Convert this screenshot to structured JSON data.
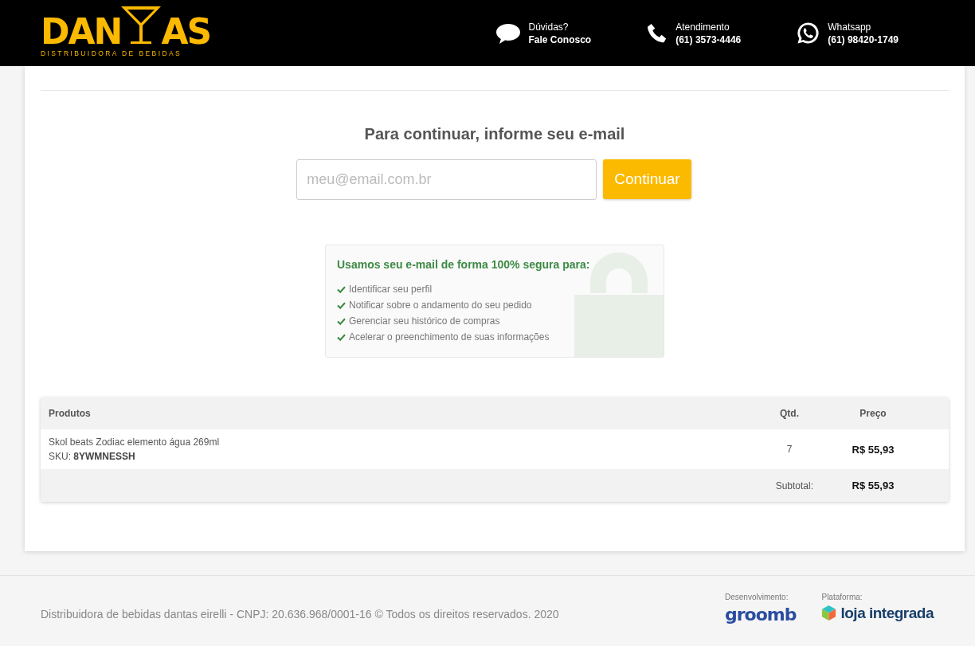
{
  "header": {
    "logo": {
      "left": "DAN",
      "right": "AS",
      "tagline": "DISTRIBUIDORA DE BEBIDAS"
    },
    "contacts": [
      {
        "kind": "chat",
        "label": "Dúvidas?",
        "value": "Fale Conosco"
      },
      {
        "kind": "phone",
        "label": "Atendimento",
        "value": "(61) 3573-4446"
      },
      {
        "kind": "whatsapp",
        "label": "Whatsapp",
        "value": "(61) 98420-1749"
      }
    ]
  },
  "email_step": {
    "title": "Para continuar, informe seu e-mail",
    "placeholder": "meu@email.com.br",
    "button": "Continuar"
  },
  "security": {
    "title": "Usamos seu e-mail de forma 100% segura para:",
    "items": [
      "Identificar seu perfil",
      "Notificar sobre o andamento do seu pedido",
      "Gerenciar seu histórico de compras",
      "Acelerar o preenchimento de suas informações"
    ]
  },
  "cart": {
    "columns": [
      "Produtos",
      "Qtd.",
      "Preço"
    ],
    "rows": [
      {
        "name": "Skol beats Zodiac elemento água 269ml",
        "sku_label": "SKU:",
        "sku": "8YWMNESSH",
        "qty": "7",
        "price": "R$ 55,93"
      }
    ],
    "subtotal_label": "Subtotal:",
    "subtotal": "R$ 55,93"
  },
  "footer": {
    "copyright": "Distribuidora de bebidas dantas eirelli - CNPJ: 20.636.968/0001-16 © Todos os direitos reservados. 2020",
    "dev_label": "Desenvolvimento:",
    "dev_logo": "groomb",
    "platform_label": "Plataforma:",
    "platform_logo": "loja integrada"
  }
}
